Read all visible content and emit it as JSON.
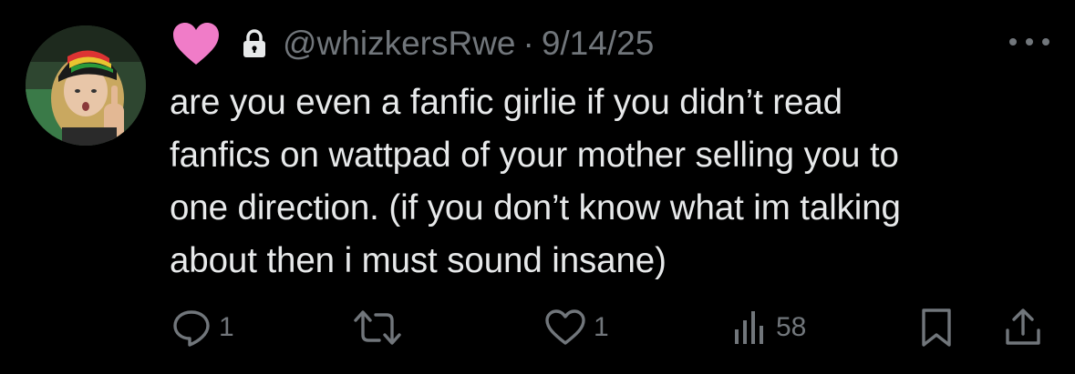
{
  "tweet": {
    "author_emoji": "pink-heart",
    "handle": "@whizkersRwe",
    "separator": "·",
    "date": "9/14/25",
    "text": "are you even a fanfic girlie if you didn’t read\nfanfics on wattpad of your mother selling you to\none direction. (if you don’t know what im talking\nabout then i must sound insane)"
  },
  "actions": {
    "replies": "1",
    "likes": "1",
    "views": "58"
  },
  "colors": {
    "background": "#000000",
    "text": "#e7e9ea",
    "secondary": "#71767b",
    "heart": "#f07cc8"
  }
}
